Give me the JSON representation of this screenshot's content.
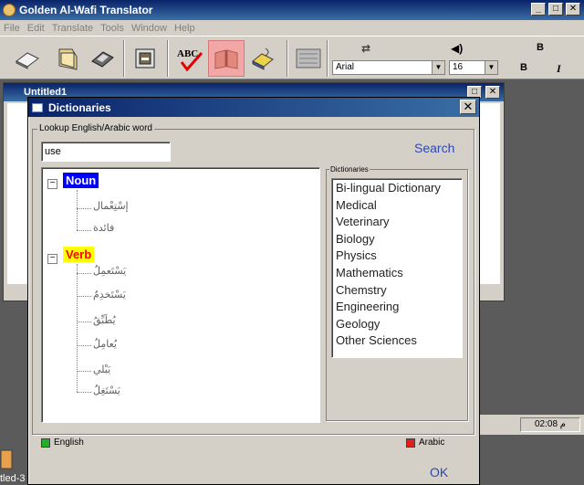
{
  "app": {
    "title": "Golden Al-Wafi Translator",
    "window_buttons": [
      "_",
      "□",
      "✕"
    ]
  },
  "menu": [
    "File",
    "Edit",
    "Translate",
    "Tools",
    "Window",
    "Help"
  ],
  "toolbar": {
    "font_name": "Arial",
    "font_size": "16",
    "bold_label": "B",
    "italic_label": "I",
    "bold_label_2": "B",
    "active_tool": "dictionary-book"
  },
  "document_window": {
    "title": "Untitled1"
  },
  "status": {
    "time": "م 02:08"
  },
  "taskbar": {
    "label": "tled-3"
  },
  "dialog": {
    "title": "Dictionaries",
    "close_label": "✕",
    "lookup_legend": "Lookup English/Arabic word",
    "search_value": "use",
    "search_label": "Search",
    "dictionaries_legend": "Dictionaries",
    "tree": {
      "noun_label": "Noun",
      "noun_items": [
        "إسْتِعْمال",
        "فائدة"
      ],
      "verb_label": "Verb",
      "verb_items": [
        "يَسْتَعمِلُ",
        "يَسْتَخدِمُ",
        "يُطَبِّقُ",
        "يُعامِلُ",
        "يَبْلي",
        "يَسْتَغِلُ"
      ]
    },
    "dictionaries": [
      "Bi-lingual Dictionary",
      "Medical",
      "Veterinary",
      "Biology",
      "Physics",
      "Mathematics",
      "Chemstry",
      "Engineering",
      "Geology",
      "Other Sciences"
    ],
    "lang_english": "English",
    "lang_arabic": "Arabic",
    "ok_label": "OK"
  },
  "colors": {
    "title_gradient_start": "#0a246a",
    "title_gradient_end": "#3a6ea5",
    "noun_bg": "#0000ff",
    "verb_bg": "#ffff00",
    "verb_text": "#ff0000",
    "link_blue": "#2c48b6",
    "active_tool_bg": "#f2a6a6"
  }
}
